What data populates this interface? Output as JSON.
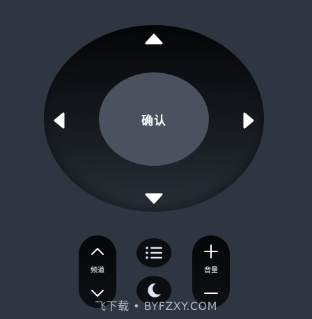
{
  "remote": {
    "ok_label": "确认",
    "channel_label": "频道",
    "volume_label": "音量"
  },
  "icons": {
    "up": "triangle-up-icon",
    "down": "triangle-down-icon",
    "left": "triangle-left-icon",
    "right": "triangle-right-icon",
    "channel_up": "chevron-up-icon",
    "channel_down": "chevron-down-icon",
    "volume_up": "plus-icon",
    "volume_down": "minus-icon",
    "menu": "list-icon",
    "sleep": "moon-icon"
  },
  "watermark": "飞下载 • BYFZXY.COM",
  "colors": {
    "background": "#2f3541",
    "dpad_dark": "#050607",
    "ok_fill": "#4b515e",
    "icon_light": "#dfe6f3"
  }
}
